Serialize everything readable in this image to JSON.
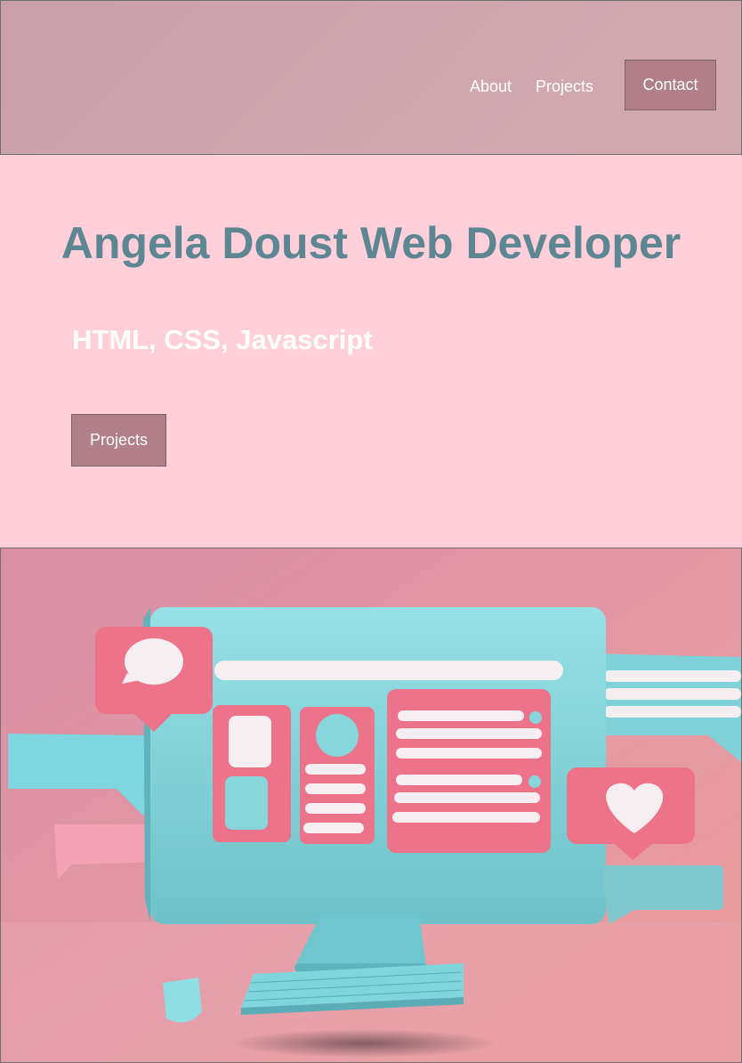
{
  "nav": {
    "about_label": "About",
    "projects_label": "Projects",
    "contact_label": "Contact"
  },
  "hero": {
    "title": "Angela Doust Web Developer",
    "subtitle": "HTML, CSS, Javascript",
    "projects_button_label": "Projects"
  },
  "illustration": {
    "icons": [
      "speech-bubble-icon",
      "heart-icon",
      "monitor",
      "keyboard",
      "mouse"
    ]
  },
  "colors": {
    "header_bg": "#d4aab2",
    "page_bg": "#ffd0da",
    "button_bg": "#b07f8a",
    "title_color": "#5c8692",
    "teal": "#86d6dc",
    "coral": "#ef8090"
  }
}
